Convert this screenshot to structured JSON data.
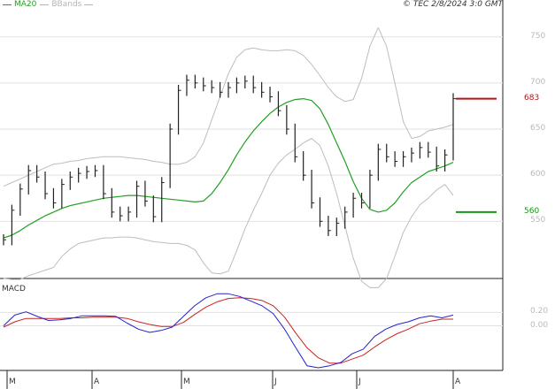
{
  "legend": {
    "ma_label": "MA20",
    "bb_label": "BBands",
    "ma_color": "#22a022",
    "bb_color": "#b4b4b4"
  },
  "timestamp": "© TEC 2/8/2024 3:0 GMT",
  "macd_title": "MACD",
  "colors": {
    "price": "#222222",
    "ma": "#22a022",
    "bands": "#bdbdbd",
    "macd": "#2222cc",
    "signal": "#cc2222",
    "resistance": "#bb1111",
    "support": "#119911",
    "grid": "#e2e2e2",
    "axis": "#222222"
  },
  "chart_data": [
    {
      "type": "line",
      "title": "",
      "ylim": [
        488,
        790
      ],
      "y_ticks": [
        "750",
        "700",
        "650",
        "600",
        "550"
      ],
      "x_ticks": [
        "M",
        "A",
        "M",
        "J",
        "J",
        "A"
      ],
      "levels": [
        {
          "name": "resistance",
          "value": 683,
          "label": "683"
        },
        {
          "name": "support",
          "value": 560,
          "label": "560"
        }
      ],
      "series": [
        {
          "name": "MA20",
          "values": [
            532,
            535,
            540,
            546,
            551,
            556,
            560,
            564,
            567,
            569,
            571,
            573,
            575,
            576,
            577,
            578,
            578,
            577,
            576,
            575,
            574,
            573,
            572,
            571,
            572,
            580,
            592,
            606,
            622,
            636,
            648,
            658,
            667,
            674,
            679,
            682,
            683,
            681,
            672,
            655,
            635,
            615,
            593,
            575,
            563,
            560,
            562,
            570,
            582,
            592,
            598,
            604,
            607,
            610,
            614
          ]
        },
        {
          "name": "BBands upper",
          "values": [
            588,
            592,
            596,
            600,
            604,
            608,
            612,
            613,
            615,
            616,
            618,
            619,
            620,
            620,
            620,
            619,
            618,
            617,
            615,
            614,
            612,
            612,
            614,
            620,
            635,
            660,
            685,
            710,
            728,
            736,
            738,
            736,
            735,
            735,
            736,
            735,
            730,
            720,
            708,
            695,
            685,
            680,
            682,
            705,
            740,
            760,
            740,
            700,
            658,
            640,
            642,
            648,
            650,
            652,
            655
          ]
        },
        {
          "name": "BBands lower",
          "values": [
            488,
            487,
            487,
            491,
            494,
            497,
            500,
            512,
            520,
            526,
            528,
            530,
            532,
            532,
            533,
            533,
            532,
            530,
            528,
            527,
            526,
            526,
            524,
            519,
            505,
            494,
            493,
            496,
            518,
            542,
            562,
            580,
            600,
            613,
            622,
            628,
            635,
            640,
            632,
            610,
            580,
            545,
            510,
            485,
            478,
            478,
            488,
            512,
            538,
            555,
            568,
            575,
            584,
            590,
            578
          ]
        },
        {
          "name": "Price",
          "values": [
            530,
            562,
            585,
            605,
            598,
            580,
            570,
            590,
            598,
            602,
            604,
            605,
            580,
            560,
            556,
            560,
            588,
            572,
            555,
            592,
            650,
            692,
            703,
            700,
            697,
            695,
            690,
            695,
            700,
            702,
            695,
            690,
            685,
            670,
            650,
            620,
            600,
            570,
            550,
            540,
            548,
            560,
            575,
            570,
            600,
            628,
            620,
            615,
            620,
            624,
            630,
            625,
            610,
            622,
            683
          ]
        }
      ]
    },
    {
      "type": "line",
      "title": "MACD",
      "ylim": [
        -0.67,
        0.67
      ],
      "y_ticks": [
        "0.20",
        "0.00"
      ],
      "series": [
        {
          "name": "MACD",
          "values": [
            0.0,
            0.16,
            0.21,
            0.14,
            0.08,
            0.09,
            0.11,
            0.15,
            0.15,
            0.15,
            0.14,
            0.04,
            -0.05,
            -0.1,
            -0.07,
            -0.02,
            0.14,
            0.3,
            0.42,
            0.48,
            0.48,
            0.44,
            0.37,
            0.3,
            0.18,
            -0.05,
            -0.33,
            -0.6,
            -0.63,
            -0.6,
            -0.55,
            -0.42,
            -0.35,
            -0.16,
            -0.05,
            0.02,
            0.06,
            0.12,
            0.15,
            0.12,
            0.16
          ]
        },
        {
          "name": "Signal",
          "values": [
            -0.02,
            0.06,
            0.11,
            0.11,
            0.11,
            0.11,
            0.12,
            0.12,
            0.13,
            0.13,
            0.13,
            0.11,
            0.06,
            0.02,
            -0.01,
            -0.01,
            0.05,
            0.17,
            0.28,
            0.36,
            0.41,
            0.42,
            0.41,
            0.38,
            0.3,
            0.13,
            -0.11,
            -0.33,
            -0.48,
            -0.56,
            -0.56,
            -0.5,
            -0.44,
            -0.32,
            -0.21,
            -0.12,
            -0.05,
            0.03,
            0.07,
            0.1,
            0.1
          ]
        }
      ]
    }
  ]
}
